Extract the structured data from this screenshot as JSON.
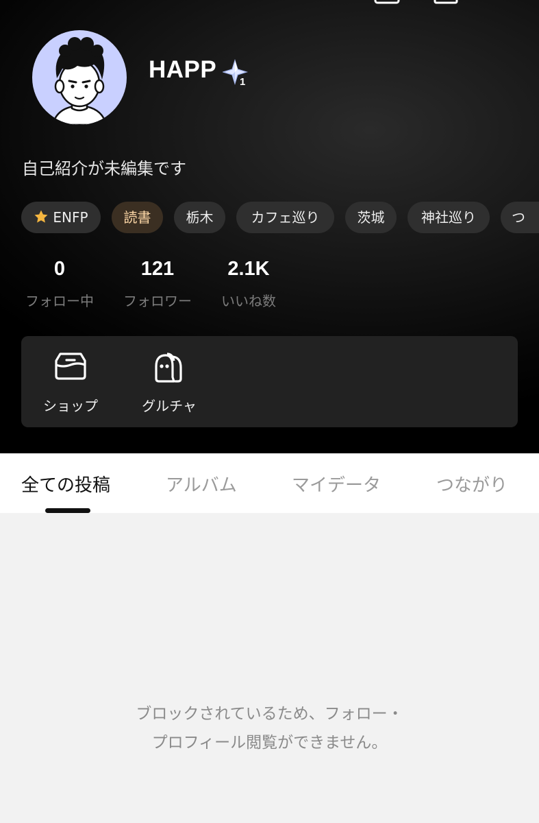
{
  "profile": {
    "username": "HAPP",
    "rank_icon": "sparkle-rank-icon",
    "rank_level": "1",
    "bio": "自己紹介が未編集です",
    "avatar_icon": "cartoon-boy-avatar",
    "avatar_bg": "#c9d0ff"
  },
  "tags": [
    {
      "label": "ENFP",
      "icon": "star-icon"
    },
    {
      "label": "読書"
    },
    {
      "label": "栃木"
    },
    {
      "label": "カフェ巡り"
    },
    {
      "label": "茨城"
    },
    {
      "label": "神社巡り"
    },
    {
      "label": "つ"
    }
  ],
  "stats": [
    {
      "value": "0",
      "label": "フォロー中"
    },
    {
      "value": "121",
      "label": "フォロワー"
    },
    {
      "value": "2.1K",
      "label": "いいね数"
    }
  ],
  "shortcuts": [
    {
      "label": "ショップ",
      "icon": "shop-icon"
    },
    {
      "label": "グルチャ",
      "icon": "group-chat-icon"
    }
  ],
  "tabs": [
    {
      "label": "全ての投稿",
      "active": true
    },
    {
      "label": "アルバム"
    },
    {
      "label": "マイデータ"
    },
    {
      "label": "つながり"
    }
  ],
  "content": {
    "blocked_message": "ブロックされているため、フォロー・\nプロフィール閲覧ができません。"
  },
  "colors": {
    "header_bg": "#000000",
    "active_tag_bg": "#3b2f22",
    "active_tag_text": "#ffd9a8",
    "star": "#f5b640"
  }
}
